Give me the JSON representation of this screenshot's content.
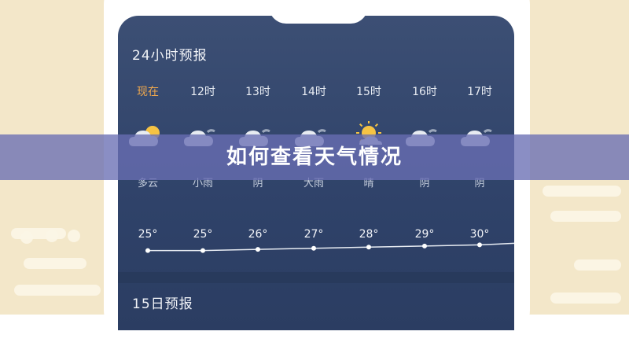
{
  "forecast24": {
    "title": "24小时预报",
    "items": [
      {
        "time": "现在",
        "icon": "partly-cloudy-icon",
        "condition": "多云",
        "temp": "25°",
        "temp_value": 25
      },
      {
        "time": "12时",
        "icon": "cloud-rain-icon",
        "condition": "小雨",
        "temp": "25°",
        "temp_value": 25
      },
      {
        "time": "13时",
        "icon": "cloud-icon",
        "condition": "阴",
        "temp": "26°",
        "temp_value": 26
      },
      {
        "time": "14时",
        "icon": "cloud-rain-icon",
        "condition": "大雨",
        "temp": "27°",
        "temp_value": 27
      },
      {
        "time": "15时",
        "icon": "sun-cloud-icon",
        "condition": "晴",
        "temp": "28°",
        "temp_value": 28
      },
      {
        "time": "16时",
        "icon": "cloud-icon",
        "condition": "阴",
        "temp": "29°",
        "temp_value": 29
      },
      {
        "time": "17时",
        "icon": "cloud-icon",
        "condition": "阴",
        "temp": "30°",
        "temp_value": 30
      }
    ]
  },
  "forecast15": {
    "title": "15日预报"
  },
  "banner": {
    "text": "如何查看天气情况"
  },
  "colors": {
    "now_accent": "#f0a84d",
    "screen_bg": "#33466c",
    "banner_bg": "#696eb4",
    "page_bg": "#f3e7c9"
  }
}
